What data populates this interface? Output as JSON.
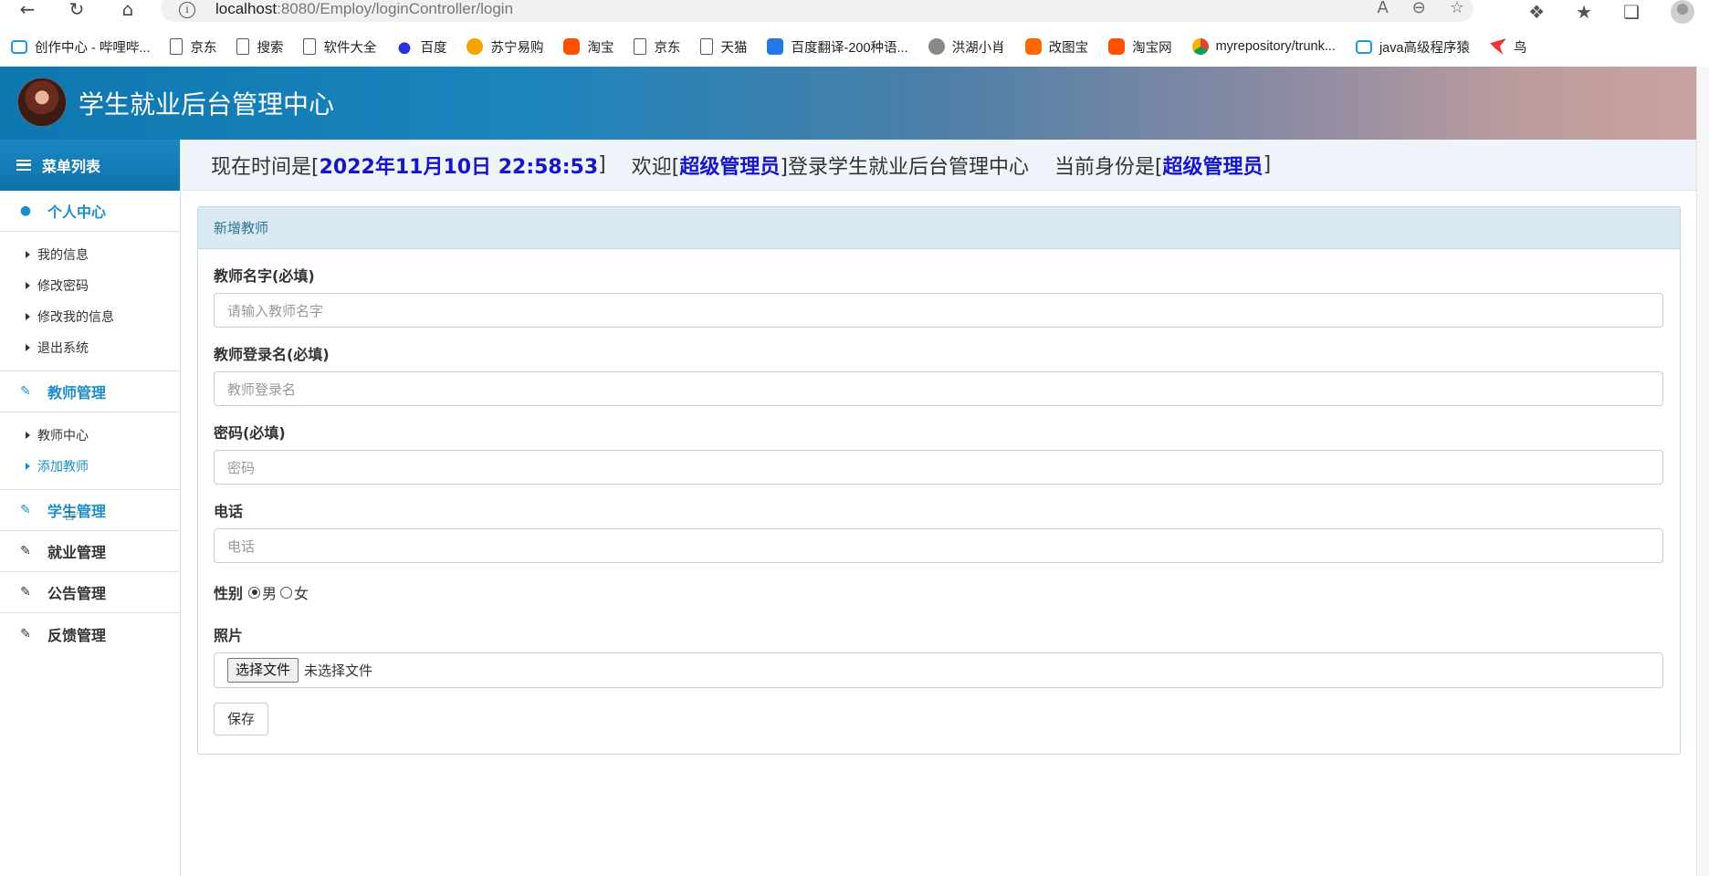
{
  "browser": {
    "back_icon": "back-arrow-icon",
    "refresh_icon": "refresh-icon",
    "home_icon": "home-icon",
    "url_host": "localhost",
    "url_rest": ":8080/Employ/loginController/login"
  },
  "bookmarks": [
    {
      "label": "创作中心 - 哔哩哔...",
      "icon": "bilibili-icon"
    },
    {
      "label": "京东",
      "icon": "page-icon"
    },
    {
      "label": "搜索",
      "icon": "page-icon"
    },
    {
      "label": "软件大全",
      "icon": "page-icon"
    },
    {
      "label": "百度",
      "icon": "baidu-icon"
    },
    {
      "label": "苏宁易购",
      "icon": "suning-icon"
    },
    {
      "label": "淘宝",
      "icon": "taobao-icon"
    },
    {
      "label": "京东",
      "icon": "page-icon"
    },
    {
      "label": "天猫",
      "icon": "page-icon"
    },
    {
      "label": "百度翻译-200种语...",
      "icon": "fanyi-icon"
    },
    {
      "label": "洪湖小肖",
      "icon": "hh-icon"
    },
    {
      "label": "改图宝",
      "icon": "gaitubao-icon"
    },
    {
      "label": "淘宝网",
      "icon": "taobao-icon"
    },
    {
      "label": "myrepository/trunk...",
      "icon": "chrome-icon"
    },
    {
      "label": "java高级程序猿",
      "icon": "bilibili-icon"
    },
    {
      "label": "鸟",
      "icon": "bird-icon"
    }
  ],
  "app": {
    "title": "学生就业后台管理中心"
  },
  "sidebar": {
    "menu_title": "菜单列表",
    "groups": [
      {
        "label": "个人中心",
        "items": [
          "我的信息",
          "修改密码",
          "修改我的信息",
          "退出系统"
        ]
      },
      {
        "label": "教师管理",
        "items": [
          "教师中心",
          "添加教师"
        ]
      },
      {
        "label": "学生管理"
      },
      {
        "label": "就业管理"
      },
      {
        "label": "公告管理"
      },
      {
        "label": "反馈管理"
      }
    ]
  },
  "status": {
    "time_prefix": "现在时间是[",
    "time_value": "2022年11月10日 22:58:53",
    "time_suffix": "]",
    "welcome_prefix": "欢迎[",
    "user": "超级管理员",
    "welcome_suffix": "]登录学生就业后台管理中心",
    "role_prefix": "当前身份是[",
    "role": "超级管理员",
    "role_suffix": "]"
  },
  "form": {
    "panel_title": "新增教师",
    "name_label": "教师名字(必填)",
    "name_placeholder": "请输入教师名字",
    "login_label": "教师登录名(必填)",
    "login_placeholder": "教师登录名",
    "password_label": "密码(必填)",
    "password_placeholder": "密码",
    "phone_label": "电话",
    "phone_placeholder": "电话",
    "gender_label": "性别",
    "gender_male": "男",
    "gender_female": "女",
    "photo_label": "照片",
    "file_button": "选择文件",
    "file_status": "未选择文件",
    "save_label": "保存"
  },
  "colors": {
    "accent": "#1b8ec9",
    "highlight": "#1515c9",
    "panel_head": "#d9eaf5"
  }
}
